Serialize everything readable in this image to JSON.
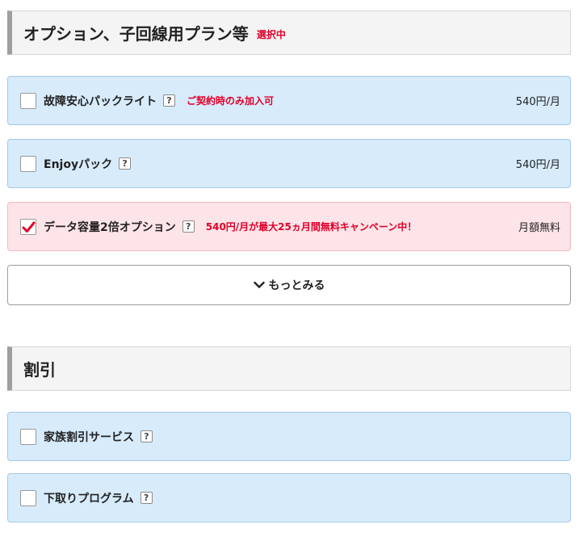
{
  "options_section": {
    "title": "オプション、子回線用プラン等",
    "badge": "選択中",
    "items": [
      {
        "label": "故障安心パックライト",
        "note": "ご契約時のみ加入可",
        "price": "540円/月",
        "checked": false
      },
      {
        "label": "Enjoyパック",
        "note": "",
        "price": "540円/月",
        "checked": false
      },
      {
        "label": "データ容量2倍オプション",
        "note": "540円/月が最大25ヵ月間無料キャンペーン中！",
        "price": "月額無料",
        "checked": true
      }
    ],
    "more_label": "もっとみる"
  },
  "discount_section": {
    "title": "割引",
    "items": [
      {
        "label": "家族割引サービス",
        "checked": false
      },
      {
        "label": "下取りプログラム",
        "checked": false
      }
    ]
  },
  "help_icon_text": "?",
  "colors": {
    "accent_red": "#e0002a",
    "option_blue_bg": "#d7ebfb",
    "option_pink_bg": "#fde4e8",
    "check_mark": "#e0002a"
  },
  "icons": {
    "help": "question-icon",
    "checked": "checkmark-icon",
    "more": "chevron-down-icon"
  }
}
